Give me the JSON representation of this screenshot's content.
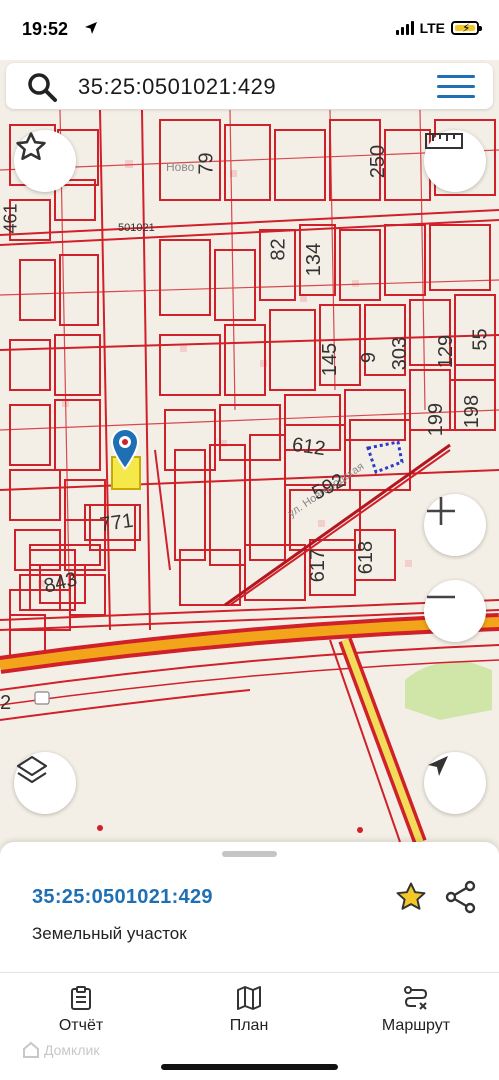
{
  "status_bar": {
    "time": "19:52",
    "network": "LTE"
  },
  "search": {
    "query": "35:25:0501021:429"
  },
  "map": {
    "labels": {
      "block": "501021",
      "street_top": "Ново",
      "street_diag": "ул. Новгородская",
      "parcels": [
        "461",
        "79",
        "250",
        "82",
        "134",
        "145",
        "9",
        "303",
        "129",
        "55",
        "199",
        "198",
        "612",
        "592",
        "771",
        "843",
        "617",
        "618",
        "2"
      ]
    }
  },
  "sheet": {
    "parcel_id": "35:25:0501021:429",
    "parcel_type": "Земельный участок"
  },
  "tabs": [
    {
      "label": "Отчёт",
      "icon": "report-icon"
    },
    {
      "label": "План",
      "icon": "map-icon"
    },
    {
      "label": "Маршрут",
      "icon": "route-icon"
    }
  ],
  "watermark": "Домклик",
  "colors": {
    "accent": "#1f6fb5",
    "parcel_line": "#d0202a",
    "road": "#f2a51a",
    "star": "#f3c72a"
  }
}
